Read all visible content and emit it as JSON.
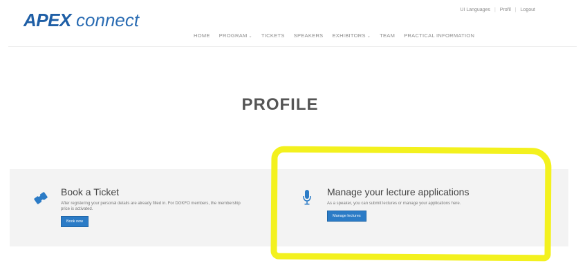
{
  "header": {
    "logo_bold": "APEX",
    "logo_rest": " connect",
    "utility": [
      "UI Languages",
      "Profil",
      "Logout"
    ],
    "nav": [
      {
        "label": "Home",
        "dropdown": false
      },
      {
        "label": "Program",
        "dropdown": true
      },
      {
        "label": "Tickets",
        "dropdown": false
      },
      {
        "label": "Speakers",
        "dropdown": false
      },
      {
        "label": "Exhibitors",
        "dropdown": true
      },
      {
        "label": "Team",
        "dropdown": false
      },
      {
        "label": "Practical Information",
        "dropdown": false
      }
    ]
  },
  "page": {
    "title": "PROFILE"
  },
  "cards": {
    "ticket": {
      "title": "Book a Ticket",
      "text": "After registering your personal details are already filled in. For DGKFO members, the membership price is activated.",
      "button": "Book now"
    },
    "lecture": {
      "title": "Manage your lecture applications",
      "text": "As a speaker, you can submit lectures or manage your applications here.",
      "button": "Manage lectures"
    }
  },
  "colors": {
    "brand": "#1f5fa6",
    "button": "#2b7bc6",
    "highlight": "#f3f11e"
  }
}
